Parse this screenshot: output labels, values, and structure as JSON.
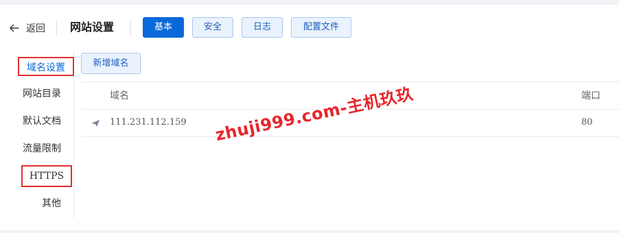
{
  "header": {
    "back_label": "返回",
    "title": "网站设置",
    "tabs": [
      {
        "label": "基本",
        "active": true
      },
      {
        "label": "安全",
        "active": false
      },
      {
        "label": "日志",
        "active": false
      },
      {
        "label": "配置文件",
        "active": false
      }
    ]
  },
  "sidebar": {
    "items": [
      {
        "label": "域名设置",
        "active": true,
        "highlighted": true
      },
      {
        "label": "网站目录"
      },
      {
        "label": "默认文档"
      },
      {
        "label": "流量限制"
      },
      {
        "label": "HTTPS",
        "highlighted": true
      },
      {
        "label": "其他"
      }
    ]
  },
  "main": {
    "add_button": "新增域名",
    "table": {
      "columns": [
        "域名",
        "端口"
      ],
      "rows": [
        {
          "domain": "111.231.112.159",
          "port": "80",
          "icon": "send-icon"
        }
      ]
    }
  },
  "watermark": "zhuji999.com-主机玖玖",
  "colors": {
    "accent": "#0969da",
    "highlight_border": "#e02f2f",
    "watermark": "#e6262a"
  }
}
